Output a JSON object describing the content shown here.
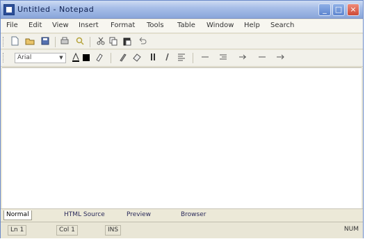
{
  "window": {
    "title": "Untitled - Notepad",
    "buttons": {
      "minimize": "_",
      "maximize": "□",
      "close": "×"
    }
  },
  "menubar": {
    "items": [
      "File",
      "Edit",
      "View",
      "Insert",
      "Format",
      "Tools",
      "Table",
      "Window",
      "Help",
      "Search"
    ]
  },
  "toolbar1": {
    "icons": [
      "new-doc-icon",
      "open-folder-icon",
      "save-icon",
      "print-icon",
      "preview-icon",
      "cut-icon",
      "copy-icon",
      "paste-icon",
      "undo-icon"
    ]
  },
  "toolbar2": {
    "font_name": "Arial",
    "font_dropdown_arrow": "▼",
    "colors": {
      "text_color": "#000000"
    }
  },
  "tabs": {
    "items": [
      "Normal",
      "HTML Source",
      "Preview",
      "Browser"
    ]
  },
  "statusbar": {
    "cells": [
      "Ln 1",
      "Col 1",
      "INS"
    ],
    "right": "NUM"
  }
}
